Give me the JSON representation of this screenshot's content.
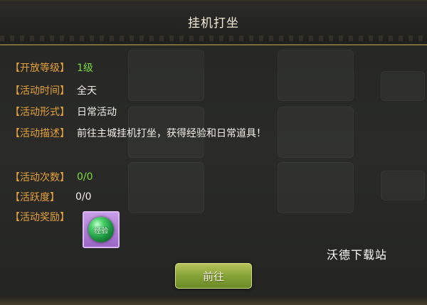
{
  "dialog": {
    "title": "挂机打坐"
  },
  "info": {
    "rows": [
      {
        "label": "【开放等级】",
        "value": "1级"
      },
      {
        "label": "【活动时间】",
        "value": "全天"
      },
      {
        "label": "【活动形式】",
        "value": "日常活动"
      },
      {
        "label": "【活动描述】",
        "value": "前往主城挂机打坐，获得经验和日常道具！"
      },
      {
        "label": "【活动次数】",
        "value": "0/0"
      },
      {
        "label": "【活跃度】",
        "value": "0/0"
      },
      {
        "label": "【活动奖励】",
        "value": ""
      }
    ]
  },
  "reward": {
    "item_label": "经验",
    "icon": "experience-orb-icon"
  },
  "button": {
    "label": "前往"
  },
  "watermark": "沃德下载站",
  "colors": {
    "label_orange": "#e6a23a",
    "value_green": "#7ed93c",
    "value_white": "#f1efe6",
    "button_green": "#89a63a",
    "slot_purple": "#b385d8"
  }
}
